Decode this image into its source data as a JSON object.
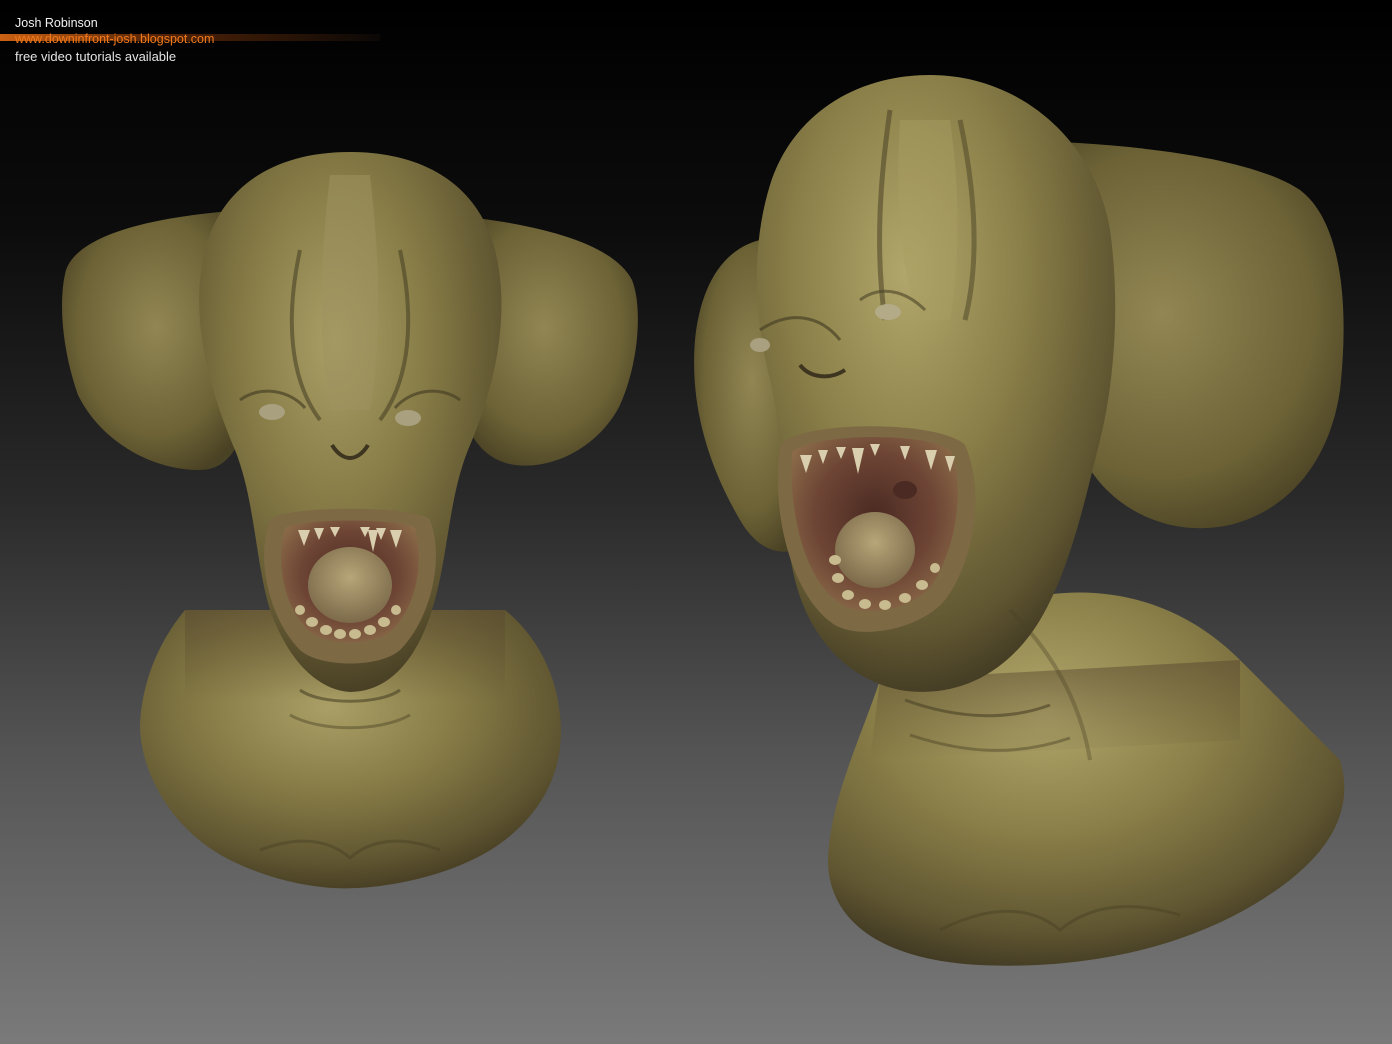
{
  "credits": {
    "author": "Josh Robinson",
    "url": "www.downinfront-josh.blogspot.com",
    "note": "free video tutorials available"
  },
  "colors": {
    "accent": "#f27a1a",
    "skin": "#7f7540",
    "background_top": "#000000",
    "background_bottom": "#7a7a7a"
  },
  "scene": {
    "subject": "sculpted creature bust",
    "views": [
      "front view",
      "three-quarter view"
    ]
  }
}
